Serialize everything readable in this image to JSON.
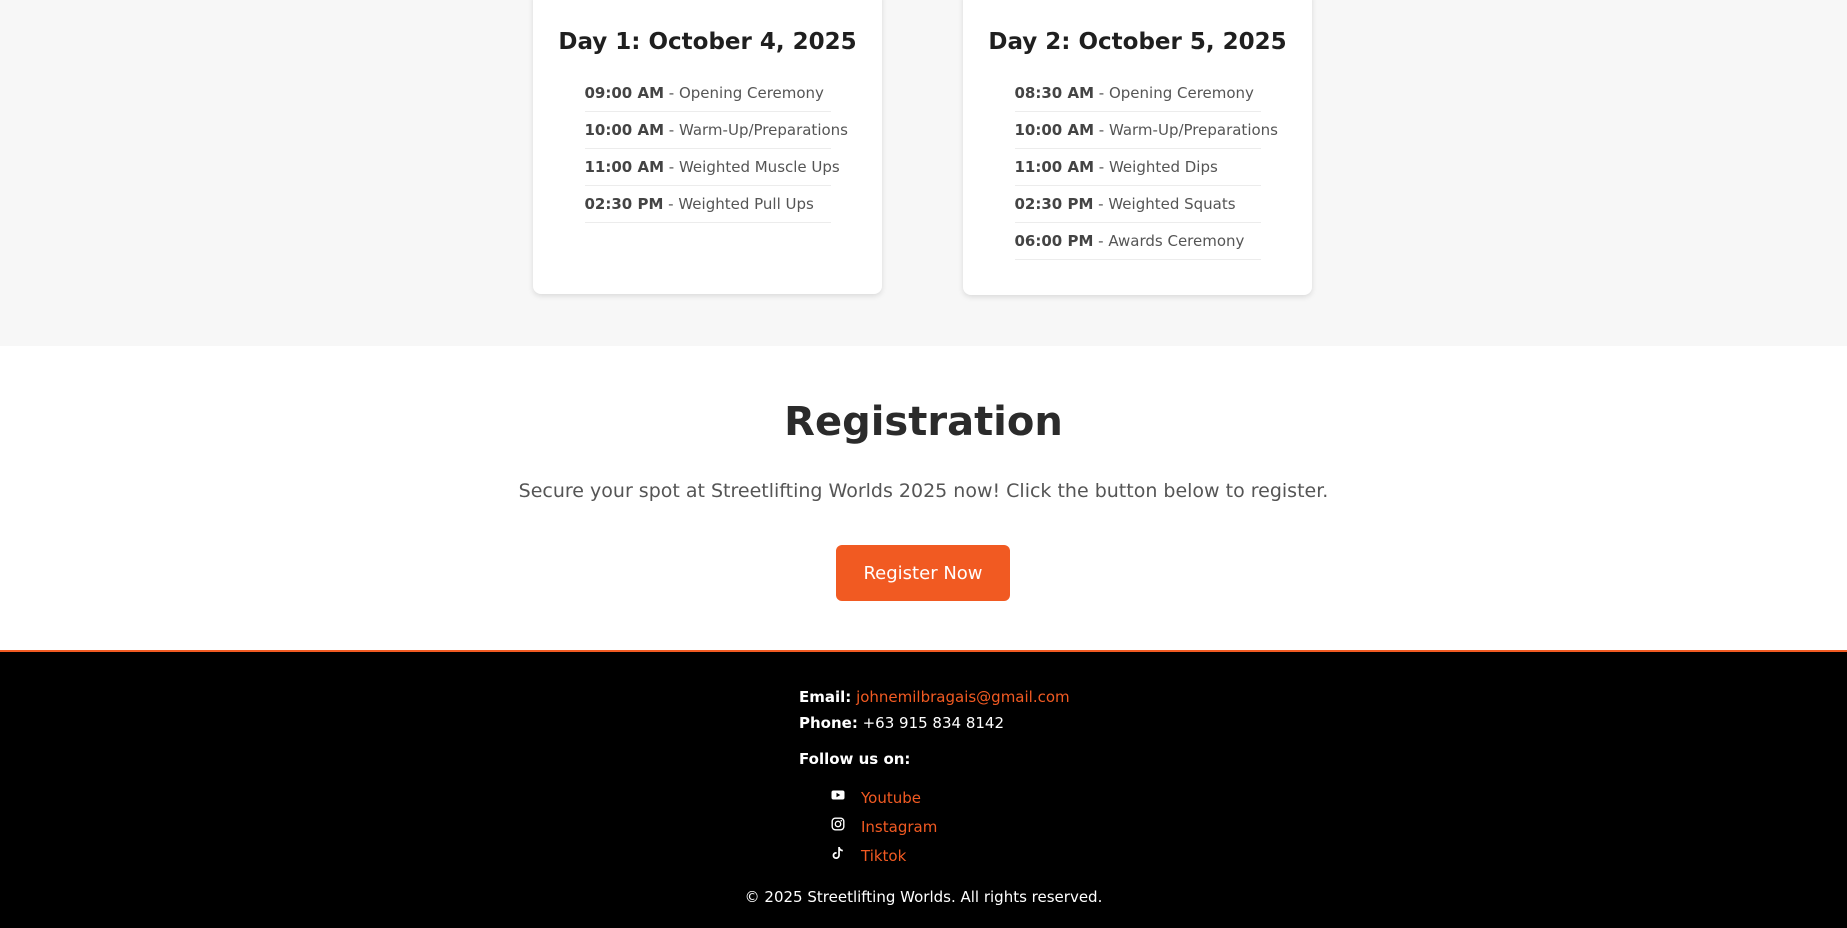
{
  "schedule": {
    "day1": {
      "title": "Day 1: October 4, 2025",
      "items": [
        {
          "time": "09:00 AM",
          "event": "Opening Ceremony"
        },
        {
          "time": "10:00 AM",
          "event": "Warm-Up/Preparations"
        },
        {
          "time": "11:00 AM",
          "event": "Weighted Muscle Ups"
        },
        {
          "time": "02:30 PM",
          "event": "Weighted Pull Ups"
        }
      ]
    },
    "day2": {
      "title": "Day 2: October 5, 2025",
      "items": [
        {
          "time": "08:30 AM",
          "event": "Opening Ceremony"
        },
        {
          "time": "10:00 AM",
          "event": "Warm-Up/Preparations"
        },
        {
          "time": "11:00 AM",
          "event": "Weighted Dips"
        },
        {
          "time": "02:30 PM",
          "event": "Weighted Squats"
        },
        {
          "time": "06:00 PM",
          "event": "Awards Ceremony"
        }
      ]
    },
    "separator": " - "
  },
  "registration": {
    "title": "Registration",
    "text": "Secure your spot at Streetlifting Worlds 2025 now! Click the button below to register.",
    "button": "Register Now"
  },
  "footer": {
    "email_label": "Email:",
    "email": "johnemilbragais@gmail.com",
    "phone_label": "Phone:",
    "phone": "+63 915 834 8142",
    "follow": "Follow us on:",
    "socials": [
      {
        "label": "Youtube",
        "icon": "youtube-icon"
      },
      {
        "label": "Instagram",
        "icon": "instagram-icon"
      },
      {
        "label": "Tiktok",
        "icon": "tiktok-icon"
      }
    ],
    "copyright": "© 2025 Streetlifting Worlds. All rights reserved."
  },
  "colors": {
    "accent": "#f15a22",
    "footer_bg": "#000000",
    "schedule_bg": "#f7f7f7"
  }
}
